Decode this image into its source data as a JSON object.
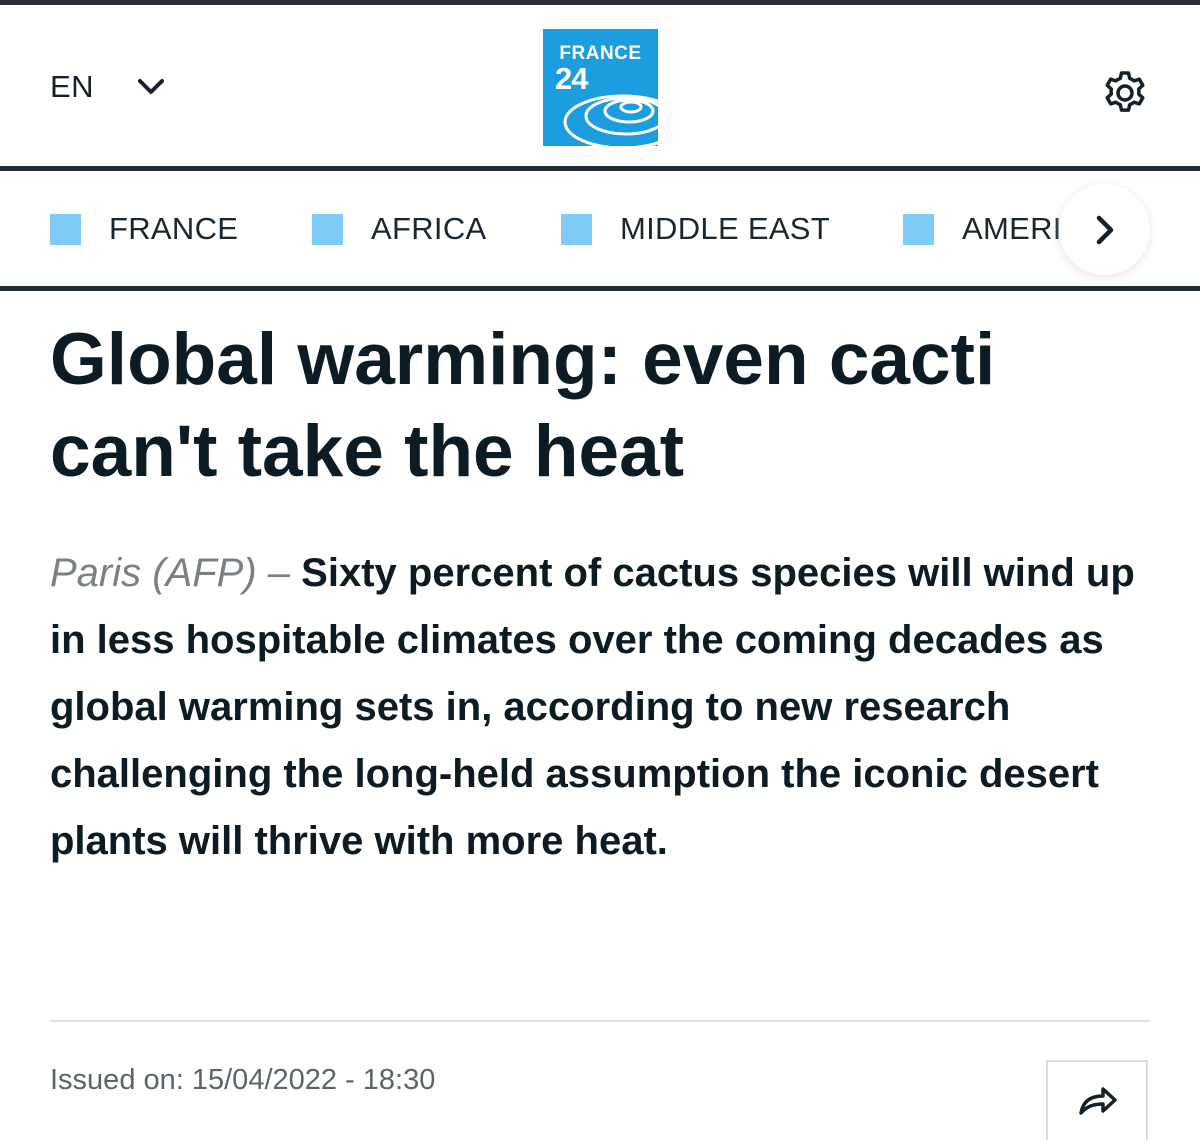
{
  "header": {
    "language": "EN",
    "logo": {
      "line1": "FRANCE",
      "line2": "24"
    }
  },
  "nav": {
    "items": [
      {
        "label": "FRANCE"
      },
      {
        "label": "AFRICA"
      },
      {
        "label": "MIDDLE EAST"
      },
      {
        "label": "AMERI"
      }
    ]
  },
  "article": {
    "headline": "Global warming: even cacti can't take the heat",
    "dateline": "Paris (AFP) –",
    "lede": "Sixty percent of cactus species will wind up in less hospitable climates over the coming decades as global warming sets in, according to new research challenging the long-held assumption the iconic desert plants will thrive with more heat.",
    "issued": "Issued on: 15/04/2022 - 18:30"
  },
  "colors": {
    "logo_blue": "#1c9ddf",
    "nav_square": "#7fcdf7",
    "text_dark": "#0d1b24",
    "rule": "#1f2b33"
  },
  "icons": {
    "language_chevron": "chevron-down-icon",
    "settings": "gear-icon",
    "nav_next": "chevron-right-icon",
    "share": "share-arrow-icon"
  }
}
